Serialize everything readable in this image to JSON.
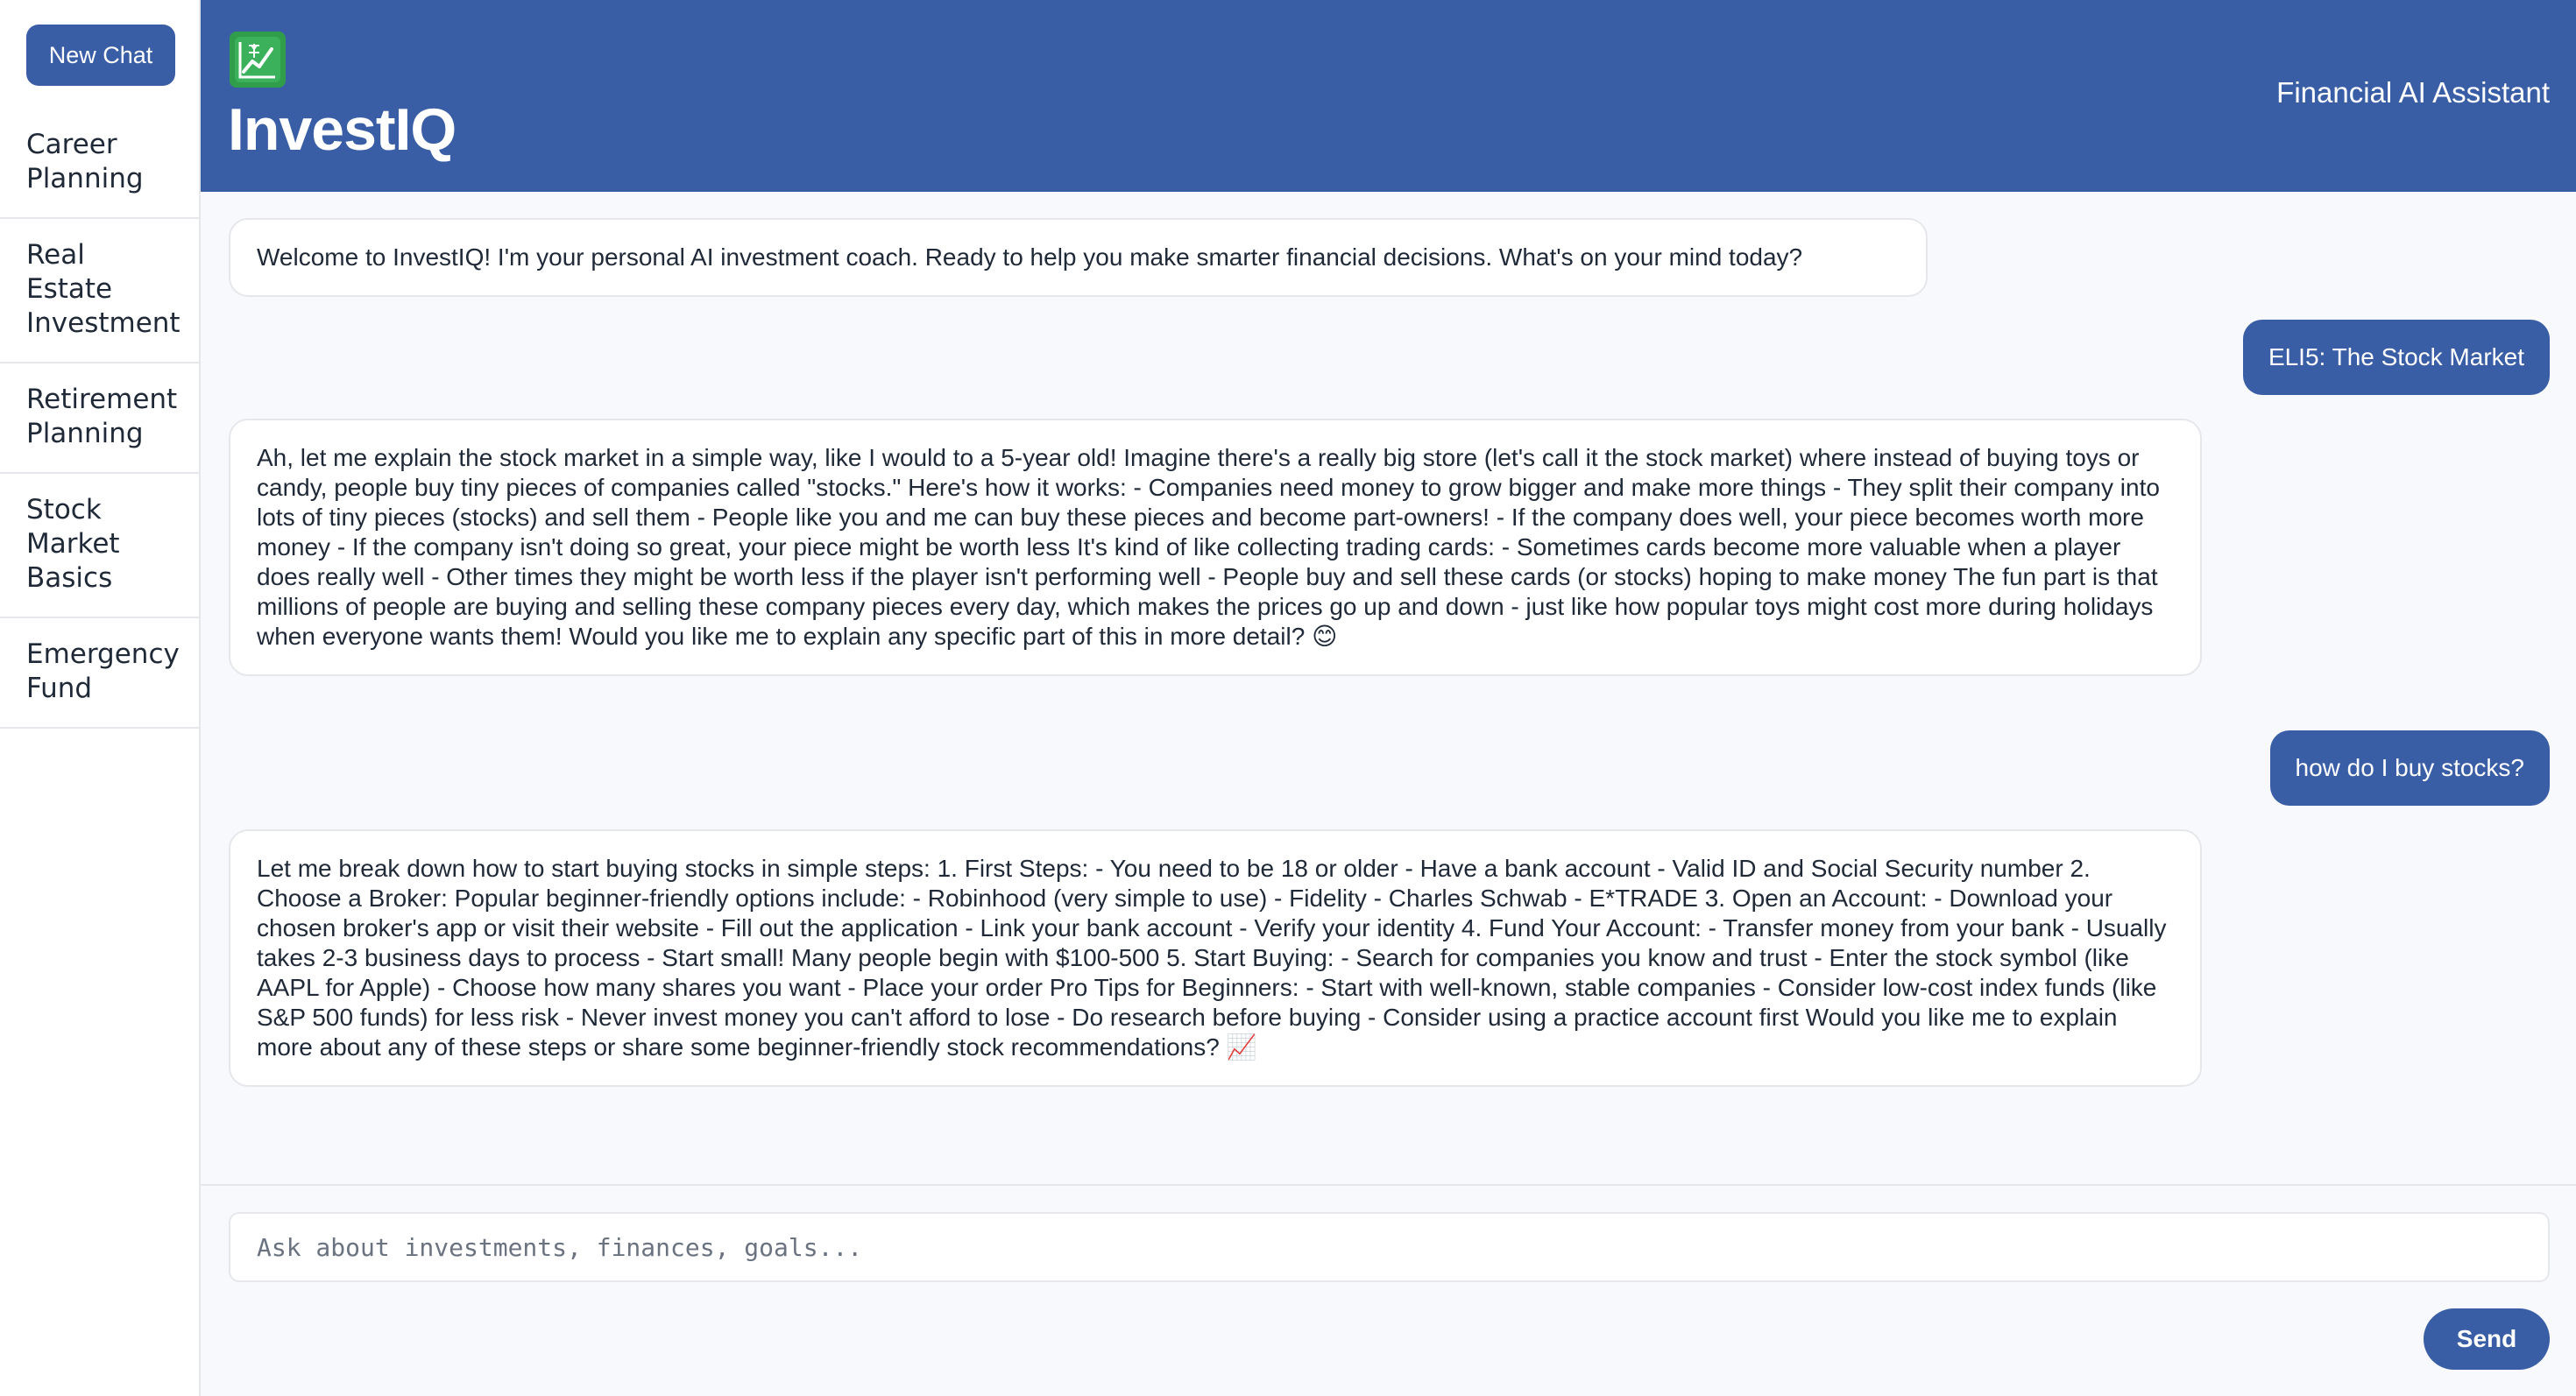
{
  "sidebar": {
    "new_chat_label": "New Chat",
    "topics": [
      {
        "label": "Career Planning"
      },
      {
        "label": "Real Estate Investment"
      },
      {
        "label": "Retirement Planning"
      },
      {
        "label": "Stock Market Basics"
      },
      {
        "label": "Emergency Fund"
      }
    ]
  },
  "header": {
    "logo_icon": "chart-increasing-icon",
    "brand": "InvestIQ",
    "subtitle": "Financial AI Assistant"
  },
  "messages": [
    {
      "role": "bot",
      "text": "Welcome to InvestIQ! I'm your personal AI investment coach. Ready to help you make smarter financial decisions. What's on your mind today?"
    },
    {
      "role": "user",
      "text": "ELI5: The Stock Market"
    },
    {
      "role": "bot",
      "text": "Ah, let me explain the stock market in a simple way, like I would to a 5-year old! Imagine there's a really big store (let's call it the stock market) where instead of buying toys or candy, people buy tiny pieces of companies called \"stocks.\" Here's how it works: - Companies need money to grow bigger and make more things - They split their company into lots of tiny pieces (stocks) and sell them - People like you and me can buy these pieces and become part-owners! - If the company does well, your piece becomes worth more money - If the company isn't doing so great, your piece might be worth less It's kind of like collecting trading cards: - Sometimes cards become more valuable when a player does really well - Other times they might be worth less if the player isn't performing well - People buy and sell these cards (or stocks) hoping to make money The fun part is that millions of people are buying and selling these company pieces every day, which makes the prices go up and down - just like how popular toys might cost more during holidays when everyone wants them! Would you like me to explain any specific part of this in more detail? 😊"
    },
    {
      "role": "user",
      "text": "how do I buy stocks?"
    },
    {
      "role": "bot",
      "text": "Let me break down how to start buying stocks in simple steps: 1. First Steps: - You need to be 18 or older - Have a bank account - Valid ID and Social Security number 2. Choose a Broker: Popular beginner-friendly options include: - Robinhood (very simple to use) - Fidelity - Charles Schwab - E*TRADE 3. Open an Account: - Download your chosen broker's app or visit their website - Fill out the application - Link your bank account - Verify your identity 4. Fund Your Account: - Transfer money from your bank - Usually takes 2-3 business days to process - Start small! Many people begin with $100-500 5. Start Buying: - Search for companies you know and trust - Enter the stock symbol (like AAPL for Apple) - Choose how many shares you want - Place your order Pro Tips for Beginners: - Start with well-known, stable companies - Consider low-cost index funds (like S&P 500 funds) for less risk - Never invest money you can't afford to lose - Do research before buying - Consider using a practice account first Would you like me to explain more about any of these steps or share some beginner-friendly stock recommendations? 📈"
    }
  ],
  "composer": {
    "placeholder": "Ask about investments, finances, goals...",
    "send_label": "Send"
  }
}
